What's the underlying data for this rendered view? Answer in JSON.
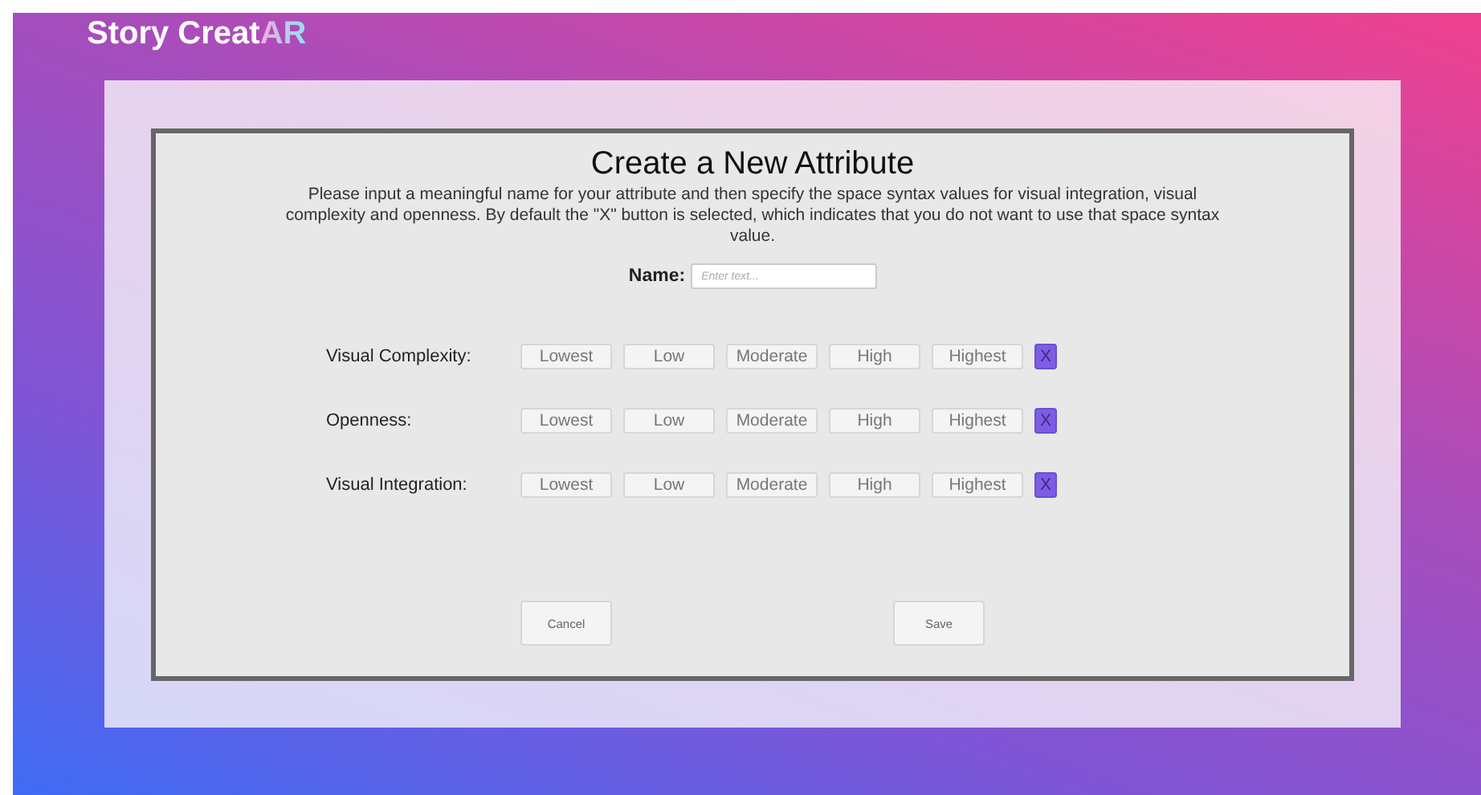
{
  "app_title": {
    "text": "Story Creat",
    "accent": "AR"
  },
  "dialog": {
    "title": "Create a New Attribute",
    "description": "Please input a meaningful name for your attribute and then specify the space syntax values for visual integration, visual complexity and openness. By default the \"X\" button is selected, which indicates that you do not want to use that space syntax value.",
    "name_label": "Name:",
    "name_placeholder": "Enter text...",
    "attributes": [
      {
        "label": "Visual Complexity:",
        "options": [
          {
            "label": "Lowest",
            "selected": false
          },
          {
            "label": "Low",
            "selected": false
          },
          {
            "label": "Moderate",
            "selected": false
          },
          {
            "label": "High",
            "selected": false
          },
          {
            "label": "Highest",
            "selected": false
          },
          {
            "label": "X",
            "selected": true
          }
        ]
      },
      {
        "label": "Openness:",
        "options": [
          {
            "label": "Lowest",
            "selected": false
          },
          {
            "label": "Low",
            "selected": false
          },
          {
            "label": "Moderate",
            "selected": false
          },
          {
            "label": "High",
            "selected": false
          },
          {
            "label": "Highest",
            "selected": false
          },
          {
            "label": "X",
            "selected": true
          }
        ]
      },
      {
        "label": "Visual Integration:",
        "options": [
          {
            "label": "Lowest",
            "selected": false
          },
          {
            "label": "Low",
            "selected": false
          },
          {
            "label": "Moderate",
            "selected": false
          },
          {
            "label": "High",
            "selected": false
          },
          {
            "label": "Highest",
            "selected": false
          },
          {
            "label": "X",
            "selected": true
          }
        ]
      }
    ],
    "buttons": [
      "Cancel",
      "Save"
    ]
  }
}
